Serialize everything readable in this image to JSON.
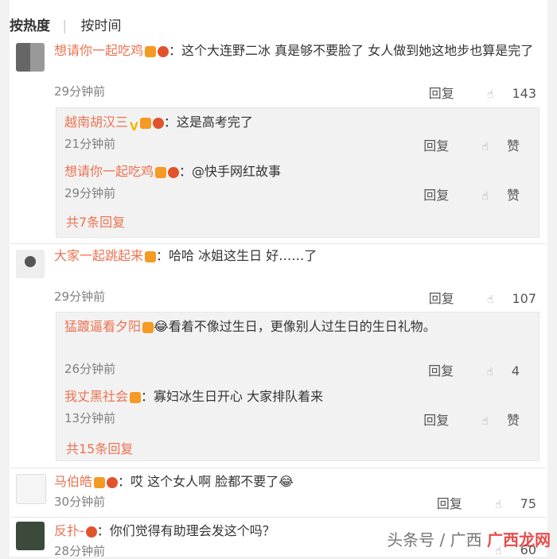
{
  "sort": {
    "hot": "按热度",
    "time": "按时间"
  },
  "comments": [
    {
      "name": "想请你一起吃鸡",
      "text": "：这个大连野二冰 真是够不要脸了 女人做到她这地步也算是完了",
      "time": "29分钟前",
      "reply_label": "回复",
      "likes": "143",
      "replies": [
        {
          "name": "越南胡汉三",
          "text": "：这是高考完了",
          "time": "21分钟前",
          "reply_label": "回复",
          "likes": "赞"
        },
        {
          "name": "想请你一起吃鸡",
          "text": "：@快手网红故事",
          "time": "29分钟前",
          "reply_label": "回复",
          "likes": "赞"
        }
      ],
      "more": "共7条回复"
    },
    {
      "name": "大家一起跳起来",
      "text": "：哈哈 冰姐这生日 好……了",
      "time": "29分钟前",
      "reply_label": "回复",
      "likes": "107",
      "replies": [
        {
          "name": "猛踱逼看夕阳",
          "text": "看着不像过生日，更像别人过生日的生日礼物。",
          "time": "26分钟前",
          "reply_label": "回复",
          "likes": "4"
        },
        {
          "name": "我丈黑社会",
          "text": "：寡妇冰生日开心 大家排队着来",
          "time": "13分钟前",
          "reply_label": "回复",
          "likes": "赞"
        }
      ],
      "more": "共15条回复"
    },
    {
      "name": "马伯皓",
      "text": "：哎 这个女人啊 脸都不要了",
      "time": "30分钟前",
      "reply_label": "回复",
      "likes": "75"
    },
    {
      "name": "反扑-",
      "text": "：你们觉得有助理会发这个吗？",
      "time": "28分钟前",
      "likes": "60"
    }
  ],
  "watermark": {
    "left": "头条号 / 广西",
    "brand": "广西龙网"
  },
  "colors": {
    "name": "#eb7350",
    "time": "#808080",
    "reply_bg": "#f2f2f2"
  },
  "icons": {
    "like": "thumb-up-icon"
  }
}
